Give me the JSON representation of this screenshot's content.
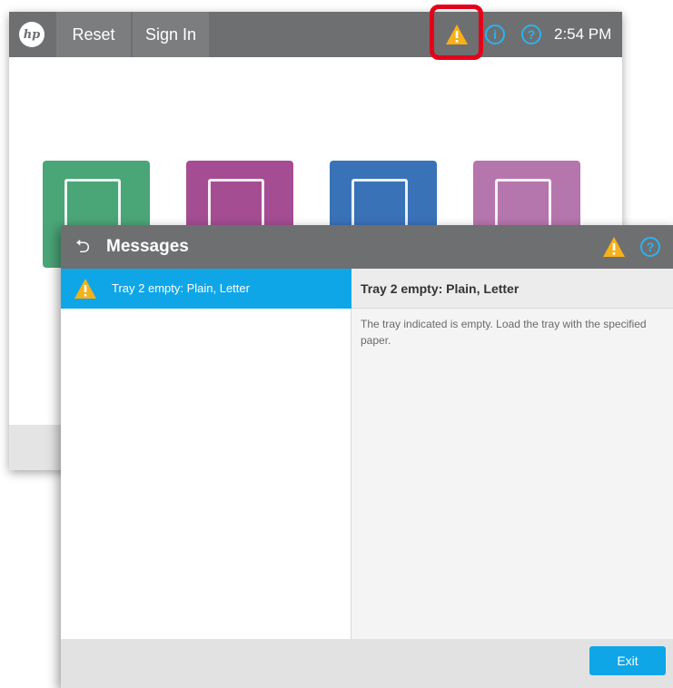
{
  "home": {
    "logo_text": "hp",
    "reset_label": "Reset",
    "signin_label": "Sign In",
    "time": "2:54 PM",
    "status_icons": [
      "warning-icon",
      "info-icon",
      "help-icon"
    ],
    "tiles": [
      {
        "name": "copy-app-icon",
        "color": "#4aa577"
      },
      {
        "name": "scan-app-icon",
        "color": "#a44d93"
      },
      {
        "name": "print-app-icon",
        "color": "#3a72b8"
      },
      {
        "name": "fax-app-icon",
        "color": "#b576ad"
      }
    ],
    "highlight_color": "#e3001b"
  },
  "dialog": {
    "title": "Messages",
    "messages": [
      {
        "label": "Tray 2 empty: Plain, Letter",
        "icon": "warning-icon",
        "selected": true
      }
    ],
    "detail": {
      "title": "Tray 2 empty: Plain, Letter",
      "body": "The tray indicated is empty. Load the tray with the specified paper."
    },
    "exit_label": "Exit"
  },
  "colors": {
    "header_gray": "#6e6f71",
    "accent_blue": "#0fa6e8",
    "warning_yellow": "#f5b11a"
  }
}
